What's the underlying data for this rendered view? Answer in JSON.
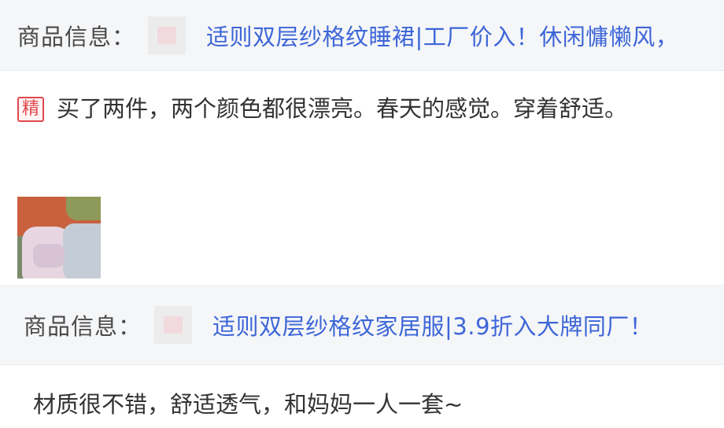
{
  "product_bar_1": {
    "label": "商品信息：",
    "thumb_icon": "product-thumbnail",
    "link": "适则双层纱格纹睡裙|工厂价入！休闲慵懒风，"
  },
  "review_1": {
    "badge": "精",
    "text": "买了两件，两个颜色都很漂亮。春天的感觉。穿着舒适。",
    "photo": "review-photo"
  },
  "product_bar_2": {
    "label": "商品信息：",
    "thumb_icon": "product-thumbnail",
    "link": "适则双层纱格纹家居服|3.9折入大牌同厂！"
  },
  "review_2": {
    "text": "材质很不错，舒适透气，和妈妈一人一套~"
  },
  "colors": {
    "link": "#3d66d8",
    "badge": "#e0484c",
    "bar_bg": "#f5f6f8"
  }
}
